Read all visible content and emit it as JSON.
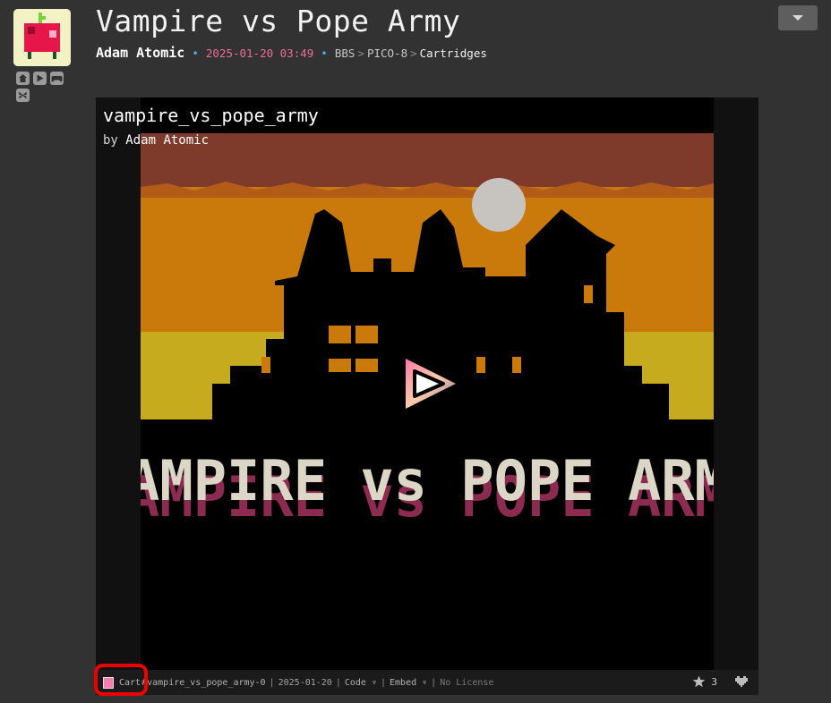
{
  "post": {
    "title": "Vampire vs Pope Army",
    "author": "Adam Atomic",
    "bullet": "•",
    "date": "2025-01-20 03:49",
    "breadcrumb": [
      "BBS",
      "PICO-8",
      "Cartridges"
    ],
    "breadcrumb_sep": ">"
  },
  "cart": {
    "title": "vampire_vs_pope_army",
    "by_word": "by",
    "author": "Adam Atomic",
    "splash_text": "VAMPIRE vs POPE ARMY"
  },
  "footer": {
    "cart_label": "Cart",
    "cart_id": "#vampire_vs_pope_army-0",
    "date": "2025-01-20",
    "code_label": "Code ▿",
    "embed_label": "Embed ▿",
    "license": "No License",
    "separator": "|",
    "star_count": "3"
  },
  "icons": {
    "nav": [
      "home-icon",
      "play-icon",
      "gamepad-icon",
      "butterfly-icon"
    ],
    "menu": "chevron-down-icon",
    "star": "star-icon",
    "heart": "heart-icon"
  },
  "colors": {
    "background": "#323232",
    "accent_date": "#ec6d99",
    "bullet": "#4aa7e0",
    "highlight": "#ee0000"
  }
}
